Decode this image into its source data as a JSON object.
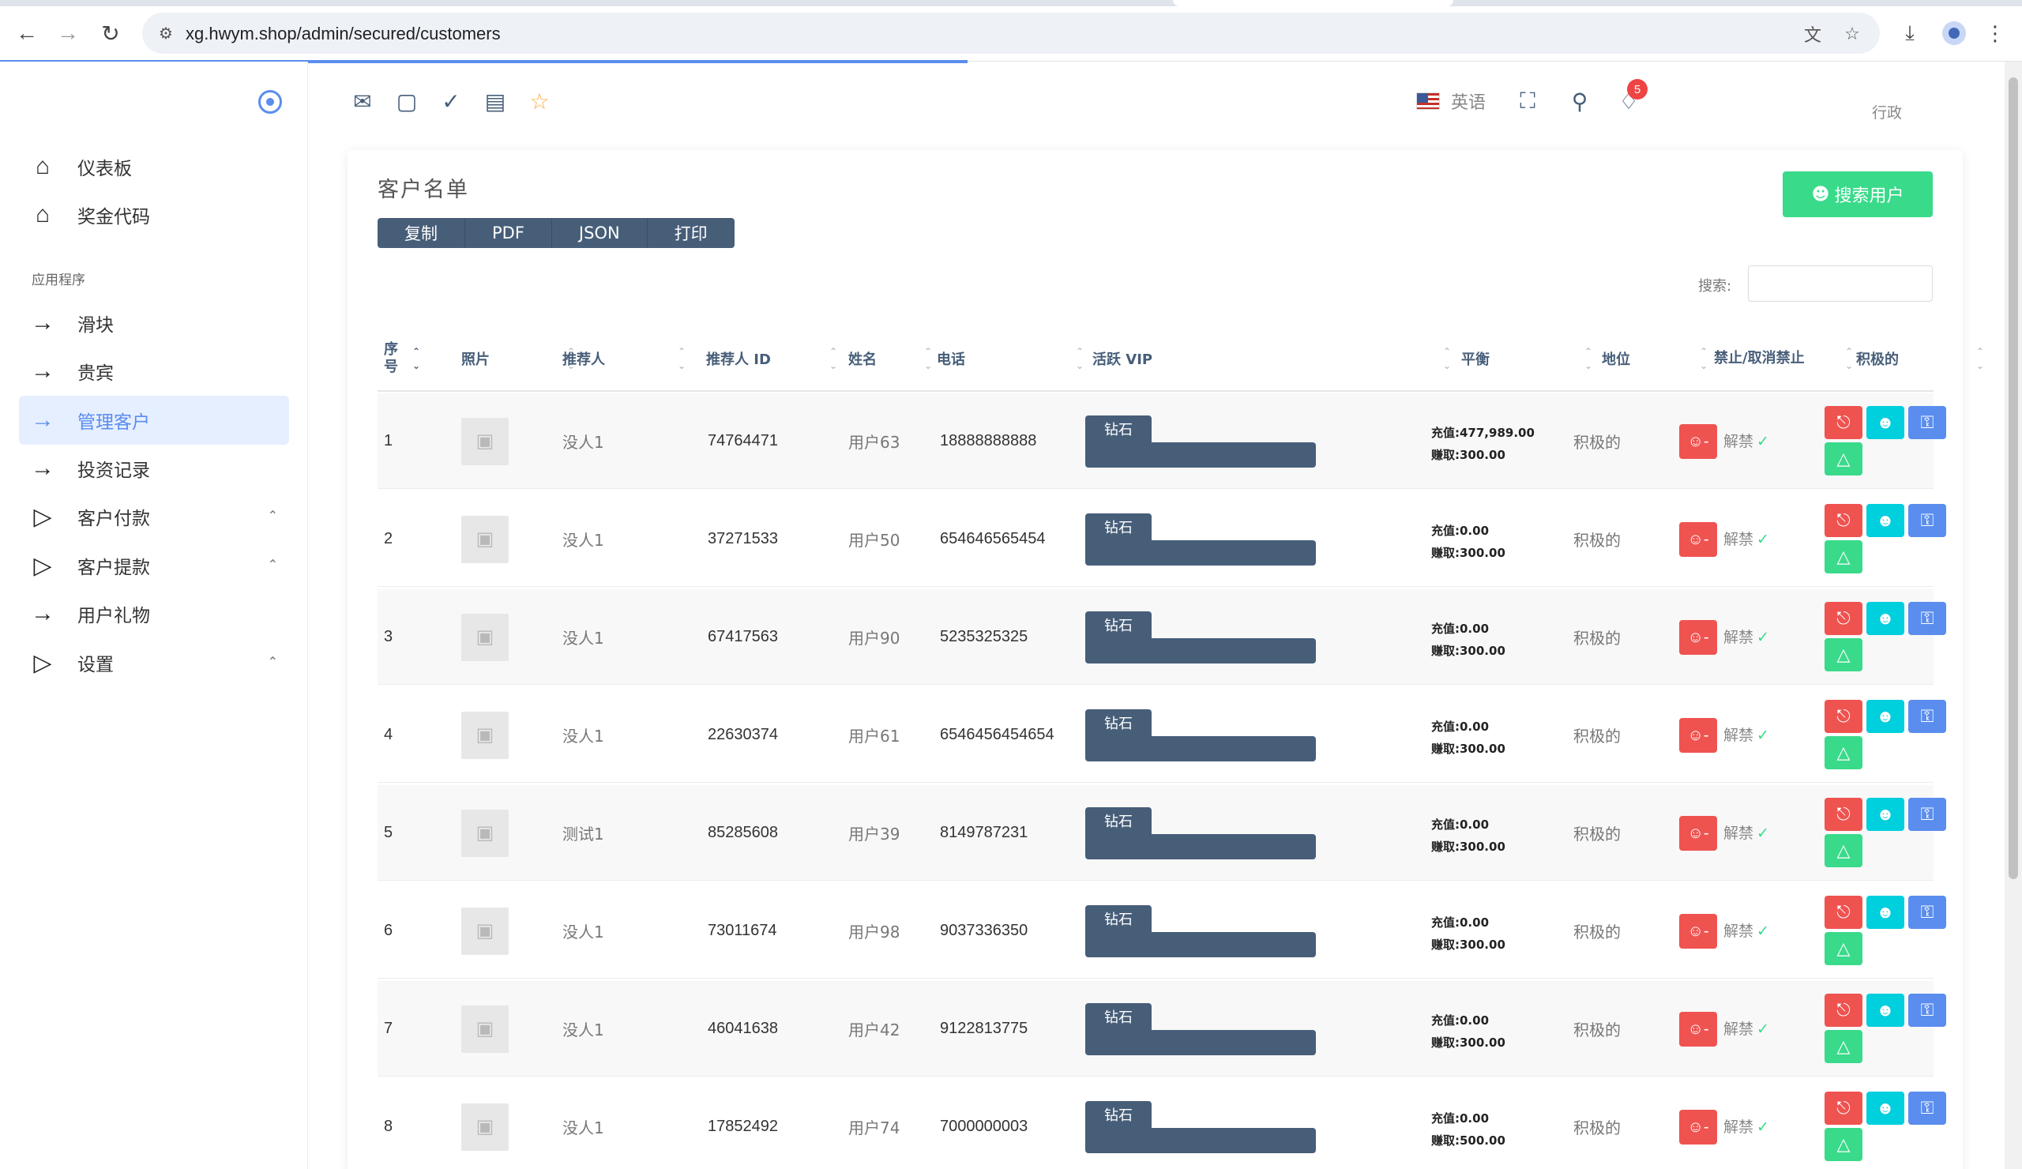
{
  "browser": {
    "url": "xg.hwym.shop/admin/secured/customers"
  },
  "sidebar": {
    "section_label": "应用程序",
    "items": [
      {
        "label": "仪表板",
        "icon": "home-icon"
      },
      {
        "label": "奖金代码",
        "icon": "home-icon"
      },
      {
        "label": "滑块",
        "icon": "arrow-right-icon"
      },
      {
        "label": "贵宾",
        "icon": "arrow-right-icon"
      },
      {
        "label": "管理客户",
        "icon": "arrow-right-icon",
        "active": true
      },
      {
        "label": "投资记录",
        "icon": "arrow-right-icon"
      },
      {
        "label": "客户付款",
        "icon": "play-icon"
      },
      {
        "label": "客户提款",
        "icon": "play-icon"
      },
      {
        "label": "用户礼物",
        "icon": "arrow-right-icon"
      },
      {
        "label": "设置",
        "icon": "play-icon"
      }
    ]
  },
  "header": {
    "language": "英语",
    "notification_count": "5",
    "user_role": "行政"
  },
  "card": {
    "title": "客户名单",
    "export_buttons": [
      "复制",
      "PDF",
      "JSON",
      "打印"
    ],
    "search_user_button": "搜索用户",
    "search_label": "搜索:"
  },
  "table": {
    "headers": [
      "序号",
      "照片",
      "推荐人",
      "推荐人 ID",
      "姓名",
      "电话",
      "活跃 VIP",
      "平衡",
      "地位",
      "禁止/取消禁止",
      "积极的"
    ],
    "vip_label": "钻石",
    "recharge_label": "充值:",
    "earned_label": "赚取:",
    "unban_label": "解禁",
    "rows": [
      {
        "no": "1",
        "referrer": "没人1",
        "referrer_id": "74764471",
        "name": "用户63",
        "phone": "18888888888",
        "recharge": "477,989.00",
        "earned": "300.00",
        "status": "积极的"
      },
      {
        "no": "2",
        "referrer": "没人1",
        "referrer_id": "37271533",
        "name": "用户50",
        "phone": "654646565454",
        "recharge": "0.00",
        "earned": "300.00",
        "status": "积极的"
      },
      {
        "no": "3",
        "referrer": "没人1",
        "referrer_id": "67417563",
        "name": "用户90",
        "phone": "5235325325",
        "recharge": "0.00",
        "earned": "300.00",
        "status": "积极的"
      },
      {
        "no": "4",
        "referrer": "没人1",
        "referrer_id": "22630374",
        "name": "用户61",
        "phone": "6546456454654",
        "recharge": "0.00",
        "earned": "300.00",
        "status": "积极的"
      },
      {
        "no": "5",
        "referrer": "测试1",
        "referrer_id": "85285608",
        "name": "用户39",
        "phone": "8149787231",
        "recharge": "0.00",
        "earned": "300.00",
        "status": "积极的"
      },
      {
        "no": "6",
        "referrer": "没人1",
        "referrer_id": "73011674",
        "name": "用户98",
        "phone": "9037336350",
        "recharge": "0.00",
        "earned": "300.00",
        "status": "积极的"
      },
      {
        "no": "7",
        "referrer": "没人1",
        "referrer_id": "46041638",
        "name": "用户42",
        "phone": "9122813775",
        "recharge": "0.00",
        "earned": "300.00",
        "status": "积极的"
      },
      {
        "no": "8",
        "referrer": "没人1",
        "referrer_id": "17852492",
        "name": "用户74",
        "phone": "7000000003",
        "recharge": "0.00",
        "earned": "500.00",
        "status": "积极的"
      }
    ]
  },
  "colors": {
    "primary": "#5a8dee",
    "success": "#39da8a",
    "danger": "#ef5350",
    "info": "#00cfdd",
    "dark": "#475e79"
  }
}
